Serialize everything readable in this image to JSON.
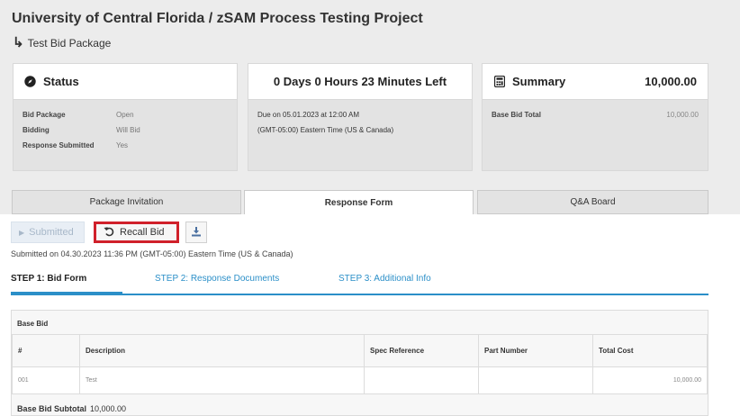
{
  "header": {
    "title": "University of Central Florida / zSAM Process Testing Project",
    "breadcrumb_arrow": "↳",
    "breadcrumb": "Test Bid Package"
  },
  "status_card": {
    "title": "Status",
    "icon": "compass-icon",
    "rows": [
      {
        "label": "Bid Package",
        "value": "Open"
      },
      {
        "label": "Bidding",
        "value": "Will Bid"
      },
      {
        "label": "Response Submitted",
        "value": "Yes"
      }
    ]
  },
  "time_card": {
    "title": "0 Days 0 Hours 23 Minutes Left",
    "due": "Due on 05.01.2023 at 12:00 AM",
    "timezone": "(GMT-05:00) Eastern Time (US & Canada)"
  },
  "summary_card": {
    "title": "Summary",
    "icon": "calculator-icon",
    "total": "10,000.00",
    "rows": [
      {
        "label": "Base Bid Total",
        "value": "10,000.00"
      }
    ]
  },
  "tabs": [
    {
      "label": "Package Invitation",
      "active": false
    },
    {
      "label": "Response Form",
      "active": true
    },
    {
      "label": "Q&A Board",
      "active": false
    }
  ],
  "actions": {
    "submitted_label": "Submitted",
    "recall_label": "Recall Bid",
    "download_icon": "download-icon",
    "submitted_note": "Submitted on 04.30.2023 11:36 PM (GMT-05:00) Eastern Time (US & Canada)"
  },
  "steps": [
    {
      "label": "STEP 1: Bid Form",
      "active": true
    },
    {
      "label": "STEP 2: Response Documents",
      "active": false
    },
    {
      "label": "STEP 3: Additional Info",
      "active": false
    }
  ],
  "bid_table": {
    "section_label": "Base Bid",
    "columns": [
      "#",
      "Description",
      "Spec Reference",
      "Part Number",
      "Total Cost"
    ],
    "rows": [
      [
        "001",
        "Test",
        "",
        "",
        "10,000.00"
      ]
    ],
    "subtotal_label": "Base Bid Subtotal",
    "subtotal_value": "10,000.00"
  },
  "colors": {
    "accent": "#2b8fc8",
    "highlight": "#d0202a"
  }
}
